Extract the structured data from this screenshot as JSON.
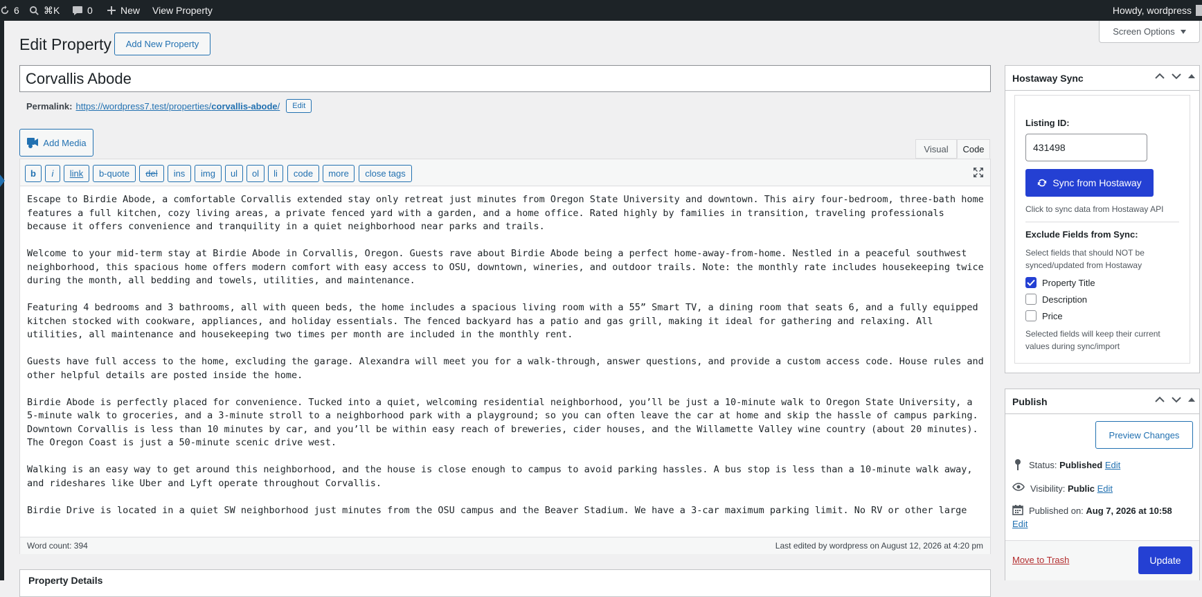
{
  "adminbar": {
    "updates_count": "6",
    "search_shortcut": "⌘K",
    "comments_count": "0",
    "new_label": "New",
    "view_label": "View Property",
    "howdy": "Howdy, wordpress"
  },
  "screen_options": "Screen Options",
  "page": {
    "title": "Edit Property",
    "add_new": "Add New Property"
  },
  "post": {
    "title": "Corvallis Abode",
    "permalink_label": "Permalink:",
    "permalink_base": "https://wordpress7.test/properties/",
    "permalink_slug": "corvallis-abode",
    "permalink_end": "/",
    "permalink_edit": "Edit"
  },
  "editor": {
    "add_media": "Add Media",
    "tab_visual": "Visual",
    "tab_code": "Code",
    "toolbar": [
      "b",
      "i",
      "link",
      "b-quote",
      "del",
      "ins",
      "img",
      "ul",
      "ol",
      "li",
      "code",
      "more",
      "close tags"
    ],
    "paragraphs": [
      "Escape to Birdie Abode, a comfortable Corvallis extended stay only retreat just minutes from Oregon State University and downtown. This airy four-bedroom, three-bath home features a full kitchen, cozy living areas, a private fenced yard with a garden, and a home office. Rated highly by families in transition, traveling professionals because it offers convenience and tranquility in a quiet neighborhood near parks and trails.",
      "Welcome to your mid-term stay at Birdie Abode in Corvallis, Oregon. Guests rave about Birdie Abode being a perfect home-away-from-home. Nestled in a peaceful southwest neighborhood, this spacious home offers modern comfort with easy access to OSU, downtown, wineries, and outdoor trails. Note: the monthly rate includes housekeeping twice during the month, all bedding and towels, utilities, and maintenance.",
      "Featuring 4 bedrooms and 3 bathrooms, all with queen beds, the home includes a spacious living room with a 55” Smart TV, a dining room that seats 6, and a fully equipped kitchen stocked with cookware, appliances, and holiday essentials. The fenced backyard has a patio and gas grill, making it ideal for gathering and relaxing.  All utilities, all maintenance and housekeeping two times per month are included in the monthly rent.",
      "Guests have full access to the home, excluding the garage. Alexandra will meet you for a walk-through, answer questions, and provide a custom access code. House rules and other helpful details are posted inside the home.",
      "Birdie Abode is perfectly placed for convenience. Tucked into a quiet, welcoming residential neighborhood, you’ll be just a 10-minute walk to Oregon State University, a 5-minute walk to groceries, and a 3-minute stroll to a neighborhood park with a playground; so you can often leave the car at home and skip the hassle of campus parking. Downtown Corvallis is less than 10 minutes by car, and you’ll be within easy reach of breweries, cider houses, and the Willamette Valley wine country (about 20 minutes). The Oregon Coast is just a 50-minute scenic drive west.",
      "Walking is an easy way to get around this neighborhood, and the house is close enough to campus to avoid parking hassles. A bus stop is less than a 10-minute walk away, and rideshares like Uber and Lyft operate throughout Corvallis.",
      "Birdie Drive is located in a quiet SW neighborhood just minutes from the OSU campus and the Beaver Stadium. We have a 3-car maximum parking limit. No RV or other large vehicles are allowed."
    ],
    "word_count": "Word count: 394",
    "last_edited": "Last edited by wordpress on August 12, 2026 at 4:20 pm"
  },
  "property_details": "Property Details",
  "hostaway": {
    "title": "Hostaway Sync",
    "listing_label": "Listing ID:",
    "listing_id": "431498",
    "sync_button": "Sync from Hostaway",
    "sync_help": "Click to sync data from Hostaway API",
    "exclude_title": "Exclude Fields from Sync:",
    "exclude_help": "Select fields that should NOT be synced/updated from Hostaway",
    "fields": [
      {
        "label": "Property Title",
        "checked": true
      },
      {
        "label": "Description",
        "checked": false
      },
      {
        "label": "Price",
        "checked": false
      }
    ],
    "footer_note": "Selected fields will keep their current values during sync/import"
  },
  "publish": {
    "title": "Publish",
    "preview": "Preview Changes",
    "status_label": "Status:",
    "status_value": "Published",
    "visibility_label": "Visibility:",
    "visibility_value": "Public",
    "published_label": "Published on:",
    "published_value": "Aug 7, 2026 at 10:58",
    "edit": "Edit",
    "trash": "Move to Trash",
    "update": "Update"
  },
  "colors": {
    "adminbar": "#1d2327",
    "link": "#2271b1",
    "primary": "#2440d3",
    "danger": "#b32d2e"
  }
}
